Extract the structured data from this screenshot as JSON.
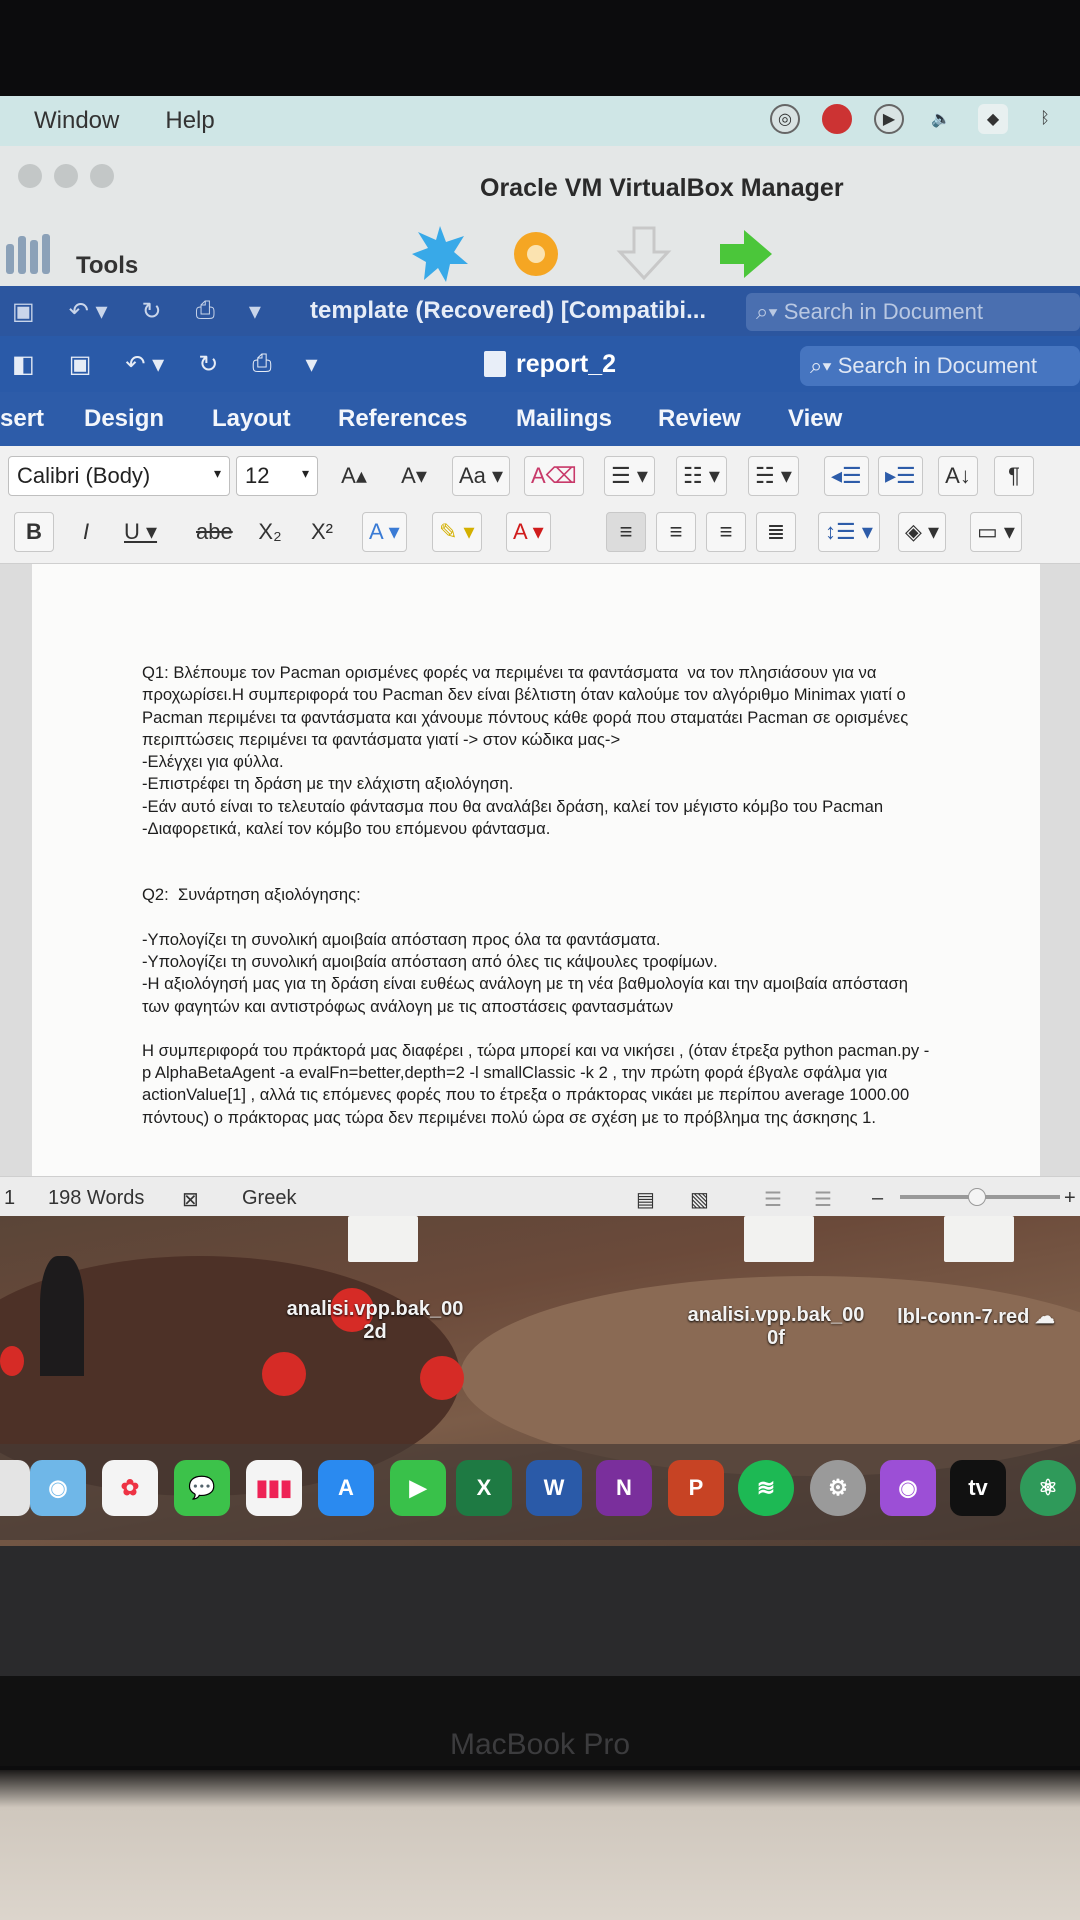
{
  "menubar": {
    "items": [
      "Window",
      "Help"
    ]
  },
  "virtualbox": {
    "title": "Oracle VM VirtualBox Manager",
    "tools_label": "Tools"
  },
  "word_template": {
    "title": "template (Recovered) [Compatibi...",
    "search_placeholder": "Search in Document"
  },
  "word_report": {
    "title": "report_2",
    "search_placeholder": "Search in Document",
    "tabs": [
      "sert",
      "Design",
      "Layout",
      "References",
      "Mailings",
      "Review",
      "View"
    ],
    "font": "Calibri (Body)",
    "font_size": "12"
  },
  "document": {
    "q1": "Q1: Βλέπουμε τον Pacman ορισμένες φορές να περιμένει τα φαντάσματα  να τον πλησιάσουν για να προχωρίσει.Η συμπεριφορά του Pacman δεν είναι βέλτιστη όταν καλούμε τον αλγόριθμο Minimax γιατί ο Pacman περιμένει τα φαντάσματα και χάνουμε πόντους κάθε φορά που σταματάει Pacman σε ορισμένες περιπτώσεις περιμένει τα φαντάσματα γιατί -> στον κώδικα μας->",
    "q1_l1": "-Ελέγχει για φύλλα.",
    "q1_l2": "-Επιστρέφει τη δράση με την ελάχιστη αξιολόγηση.",
    "q1_l3": "-Εάν αυτό είναι το τελευταίο φάντασμα που θα αναλάβει δράση, καλεί τον μέγιστο κόμβο του Pacman",
    "q1_l4": "-Διαφορετικά, καλεί τον κόμβο του επόμενου φάντασμα.",
    "q2": "Q2:  Συνάρτηση αξιολόγησης:",
    "q2_l1": "-Υπολογίζει τη συνολική αμοιβαία απόσταση προς όλα τα φαντάσματα.",
    "q2_l2": "-Υπολογίζει τη συνολική αμοιβαία απόσταση από όλες τις κάψουλες τροφίμων.",
    "q2_l3": "-Η αξιολόγησή μας για τη δράση είναι ευθέως ανάλογη με τη νέα βαθμολογία και την αμοιβαία απόσταση των φαγητών και αντιστρόφως ανάλογη με τις αποστάσεις φαντασμάτων",
    "para": "Η συμπεριφορά του πράκτορά μας διαφέρει , τώρα μπορεί και να νικήσει , (όταν έτρεξα python pacman.py -p AlphaBetaAgent -a evalFn=better,depth=2 -l smallClassic -k 2 , την πρώτη φορά έβγαλε σφάλμα για actionValue[1] , αλλά τις επόμενες φορές που το έτρεξα ο πράκτορας νικάει με περίπου average 1000.00 πόντους) ο πράκτορας μας τώρα δεν περιμένει πολύ ώρα σε σχέση με το πρόβλημα της άσκησης 1."
  },
  "statusbar": {
    "page": "1",
    "words": "198 Words",
    "language": "Greek"
  },
  "desktop": {
    "files": [
      {
        "name": "analisi.vpp.bak_00",
        "sub": "2d"
      },
      {
        "name": "analisi.vpp.bak_00",
        "sub": "0f"
      },
      {
        "name": "lbl-conn-7.red",
        "sub": ""
      }
    ]
  },
  "dock": {
    "tv_label": "tv"
  },
  "laptop": {
    "model": "MacBook Pro"
  },
  "colors": {
    "word_blue": "#2a5aa8",
    "menubar": "#cfe6e6"
  }
}
